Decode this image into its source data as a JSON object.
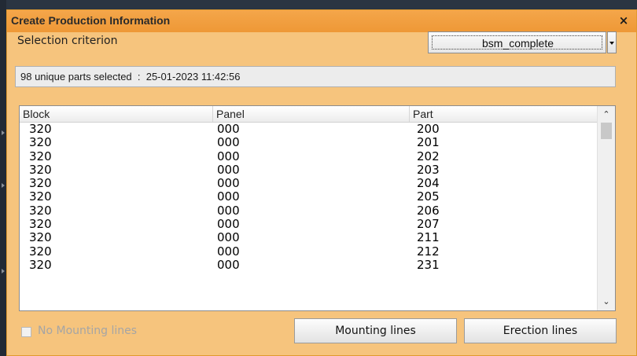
{
  "window": {
    "title": "Create Production Information",
    "close_symbol": "×"
  },
  "criterion": {
    "label": "Selection criterion",
    "selected_value": "bsm_complete"
  },
  "status": {
    "text": "98 unique parts selected  :  25-01-2023 11:42:56"
  },
  "list": {
    "columns": [
      "Block",
      "Panel",
      "Part"
    ],
    "rows": [
      [
        "320",
        "000",
        "200"
      ],
      [
        "320",
        "000",
        "201"
      ],
      [
        "320",
        "000",
        "202"
      ],
      [
        "320",
        "000",
        "203"
      ],
      [
        "320",
        "000",
        "204"
      ],
      [
        "320",
        "000",
        "205"
      ],
      [
        "320",
        "000",
        "206"
      ],
      [
        "320",
        "000",
        "207"
      ],
      [
        "320",
        "000",
        "211"
      ],
      [
        "320",
        "000",
        "212"
      ],
      [
        "320",
        "000",
        "231"
      ]
    ]
  },
  "options": {
    "no_mounting_label": "No Mounting lines",
    "no_mounting_checked": false
  },
  "buttons": {
    "mounting": "Mounting lines",
    "erection": "Erection lines"
  },
  "colors": {
    "dialog_bg": "#f6c47d",
    "titlebar": "#ee9836",
    "backdrop": "#2b3542"
  }
}
